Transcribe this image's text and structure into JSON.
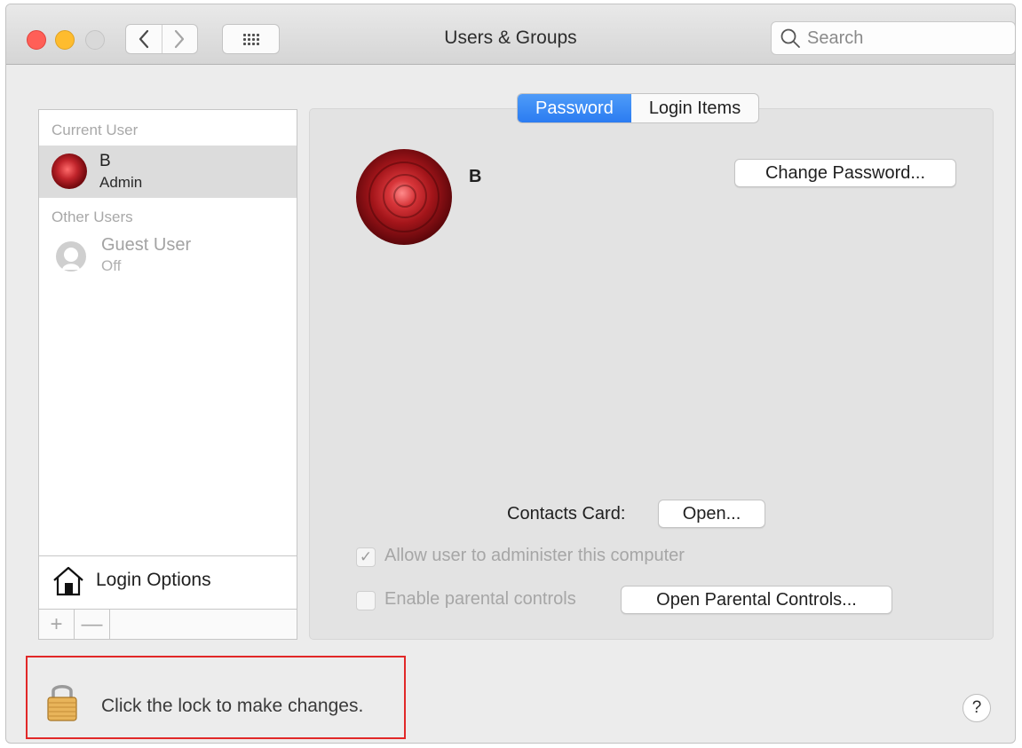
{
  "window": {
    "title": "Users & Groups",
    "search_placeholder": "Search"
  },
  "users_list": {
    "current_user_header": "Current User",
    "current_user": {
      "name": "B",
      "role": "Admin"
    },
    "other_users_header": "Other Users",
    "other_users": [
      {
        "name": "Guest User",
        "status": "Off"
      }
    ],
    "login_options_label": "Login Options",
    "add_symbol": "+",
    "remove_symbol": "—"
  },
  "tabs": [
    {
      "label": "Password",
      "active": true
    },
    {
      "label": "Login Items",
      "active": false
    }
  ],
  "detail": {
    "user_name": "B",
    "change_password_label": "Change Password...",
    "contacts_card_label": "Contacts Card:",
    "open_label": "Open...",
    "allow_admin_label": "Allow user to administer this computer",
    "allow_admin_checked": true,
    "parental_controls_label": "Enable parental controls",
    "parental_controls_checked": false,
    "open_parental_controls_label": "Open Parental Controls..."
  },
  "footer": {
    "lock_text": "Click the lock to make changes.",
    "help_symbol": "?"
  },
  "icons": {
    "back": "chevron-left-icon",
    "forward": "chevron-right-icon",
    "grid": "grid-icon",
    "search": "search-icon",
    "guest": "guest-user-icon",
    "house": "house-icon",
    "lock": "lock-icon",
    "checkmark": "✓"
  },
  "colors": {
    "accent": "#2b7cf1",
    "close": "#ff5f57",
    "minimize": "#febc2e",
    "highlight_box": "#e12828"
  }
}
